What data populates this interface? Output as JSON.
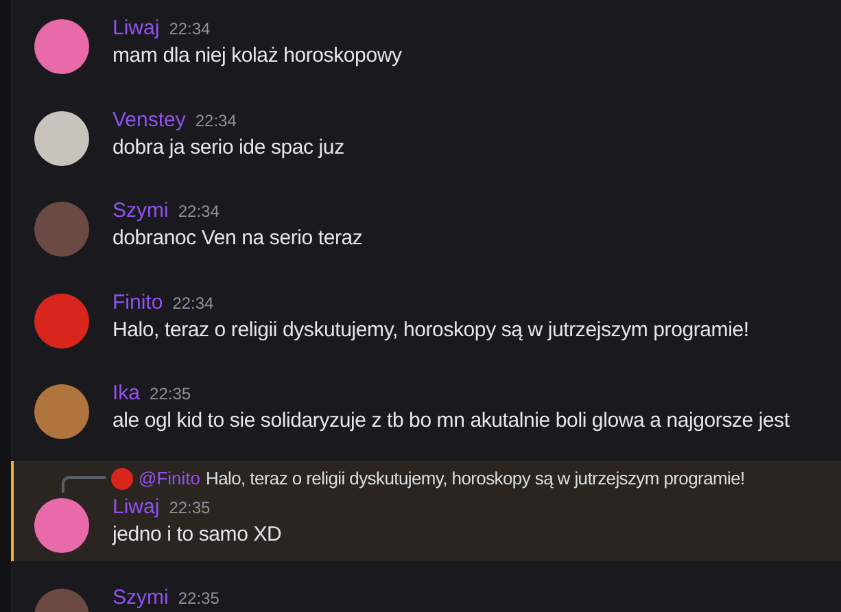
{
  "messages": [
    {
      "author": "Liwaj",
      "time": "22:34",
      "text": "mam dla niej kolaż horoskopowy",
      "color": "#e86aa8",
      "highlighted": false
    },
    {
      "author": "Venstey",
      "time": "22:34",
      "text": "dobra ja serio ide spac juz",
      "color": "#c9c3bd",
      "highlighted": false
    },
    {
      "author": "Szymi",
      "time": "22:34",
      "text": "dobranoc Ven na serio teraz",
      "color": "#6b4a44",
      "highlighted": false
    },
    {
      "author": "Finito",
      "time": "22:34",
      "text": "Halo, teraz o religii dyskutujemy, horoskopy są w jutrzejszym programie!",
      "color": "#d8261c",
      "highlighted": false
    },
    {
      "author": "Ika",
      "time": "22:35",
      "text": "ale ogl kid to sie solidaryzuje z tb bo mn akutalnie boli glowa a najgorsze jest",
      "color": "#b0743e",
      "highlighted": false
    },
    {
      "author": "Liwaj",
      "time": "22:35",
      "text": "jedno i to samo XD",
      "color": "#e86aa8",
      "highlighted": true,
      "reply": {
        "mention": "@Finito",
        "text": "Halo, teraz o religii dyskutujemy, horoskopy są w jutrzejszym programie!",
        "color": "#d8261c"
      }
    },
    {
      "author": "Szymi",
      "time": "22:35",
      "color": "#6b4a44",
      "highlighted": false
    }
  ]
}
